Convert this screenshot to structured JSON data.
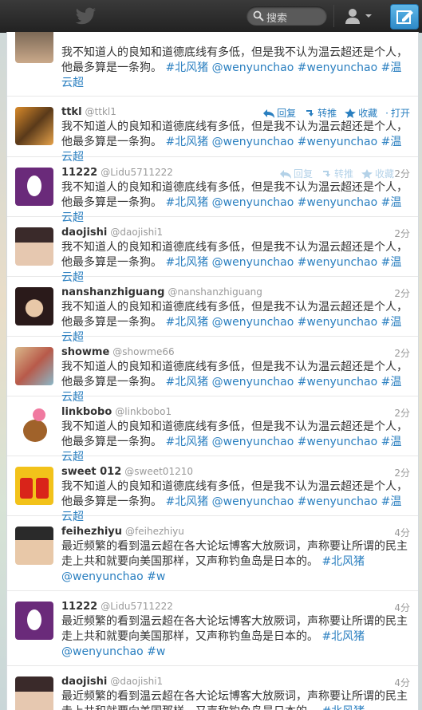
{
  "header": {
    "search_placeholder": "搜索"
  },
  "actions": {
    "reply": "回复",
    "retweet": "转推",
    "favorite": "收藏",
    "open": "打开"
  },
  "tweet_text_a": "我不知道人的良知和道德底线有多低，但是我不认为温云超还是个人，他最多算是一条狗。",
  "tweet_text_b": "最近频繁的看到温云超在各大论坛博客大放厥词，声称要让所谓的民主走上共和就要向美国那样，又声称钓鱼岛是日本的。",
  "tags_a": {
    "t1": "#北风猪",
    "t2": "@wenyunchao",
    "t3": "#wenyunchao",
    "t4": "#温云超"
  },
  "tags_b": {
    "t1": "#北风猪",
    "t2": "@wenyunchao",
    "t3": "#w"
  },
  "tweets": [
    {
      "name": "",
      "handle": "",
      "time": ""
    },
    {
      "name": "ttkl",
      "handle": "@ttkl1",
      "time": ""
    },
    {
      "name": "11222",
      "handle": "@Lidu5711222",
      "time": "2分"
    },
    {
      "name": "daojishi",
      "handle": "@daojishi1",
      "time": "2分"
    },
    {
      "name": "nanshanzhiguang",
      "handle": "@nanshanzhiguang",
      "time": "2分"
    },
    {
      "name": "showme",
      "handle": "@showme66",
      "time": "2分"
    },
    {
      "name": "linkbobo",
      "handle": "@linkbobo1",
      "time": "2分"
    },
    {
      "name": "sweet 012",
      "handle": "@sweet01210",
      "time": "2分"
    },
    {
      "name": "feihezhiyu",
      "handle": "@feihezhiyu",
      "time": "4分"
    },
    {
      "name": "11222",
      "handle": "@Lidu5711222",
      "time": "4分"
    },
    {
      "name": "daojishi",
      "handle": "@daojishi1",
      "time": "4分"
    }
  ]
}
